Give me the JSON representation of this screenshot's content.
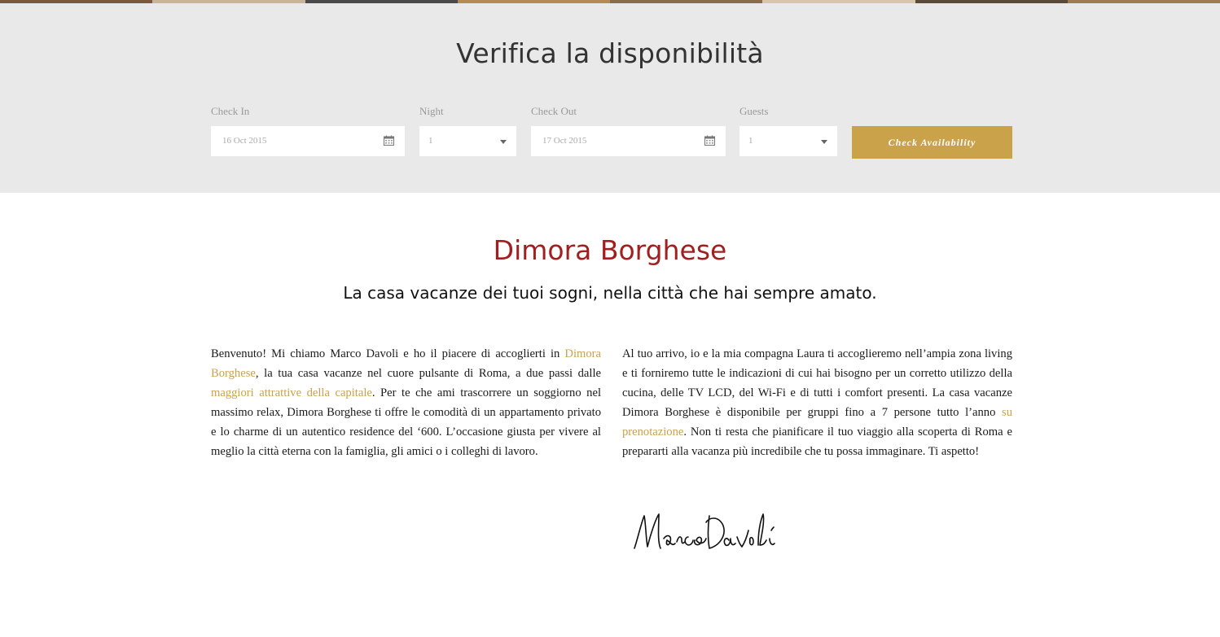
{
  "colors": {
    "panel_bg": "#e9e9e9",
    "accent_gold": "#c9a24a",
    "title_red": "#a01f1f",
    "top_strip": [
      "#7a5a3a",
      "#c9b49a",
      "#4a4a4a",
      "#b58a55",
      "#8a6b4a",
      "#d9c6a8",
      "#5a4a3a",
      "#a07a50"
    ]
  },
  "availability": {
    "heading": "Verifica la disponibilità",
    "check_in": {
      "label": "Check In",
      "value": "16 Oct 2015",
      "icon": "calendar-icon"
    },
    "nights": {
      "label": "Night",
      "value": "1",
      "icon": "chevron-down-icon"
    },
    "check_out": {
      "label": "Check Out",
      "value": "17 Oct 2015",
      "icon": "calendar-icon"
    },
    "guests": {
      "label": "Guests",
      "value": "1",
      "icon": "chevron-down-icon"
    },
    "button_label": "Check Availability"
  },
  "intro": {
    "title": "Dimora Borghese",
    "tagline": "La casa vacanze dei tuoi sogni, nella città che hai sempre amato.",
    "left": {
      "p1": "Benvenuto! Mi chiamo Marco Davoli e ho il piacere di accoglierti in ",
      "link1": "Dimora Borghese",
      "p2": ", la tua casa vacanze nel cuore pulsante di Roma, a due passi dalle ",
      "link2": "maggiori attrattive della capitale",
      "p3": ". Per te che ami trascorrere un soggiorno nel massimo relax, Dimora Borghese ti offre le comodità di un appartamento privato e lo charme di un autentico residence del ‘600. L’occasione giusta per vivere al meglio la città eterna con la famiglia, gli amici o i colleghi di lavoro."
    },
    "right": {
      "p1": "Al tuo arrivo, io e la mia compagna Laura ti accoglieremo nell’ampia zona living e ti forniremo tutte le indicazioni di cui hai bisogno per un corretto utilizzo della cucina, delle TV LCD, del Wi-Fi e di tutti i comfort presenti. La casa vacanze Dimora Borghese è disponibile per gruppi fino a 7 persone tutto l’anno ",
      "link1": "su prenotazione",
      "p2": ". Non ti resta che pianificare il tuo viaggio alla scoperta di Roma e prepararti alla vacanza più incredibile che tu possa immaginare. Ti aspetto!"
    },
    "signature": "MarcoDavoli"
  }
}
